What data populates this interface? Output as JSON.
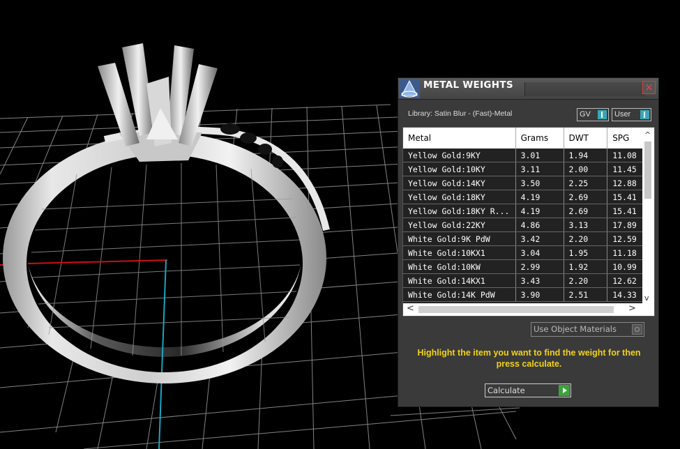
{
  "panel": {
    "title": "METAL WEIGHTS",
    "close_label": "×",
    "library": "Library: Satin Blur - (Fast)-Metal",
    "gv_label": "GV",
    "user_label": "User",
    "columns": [
      "Metal",
      "Grams",
      "DWT",
      "SPG"
    ],
    "rows": [
      [
        "Yellow Gold:9KY",
        "3.01",
        "1.94",
        "11.08"
      ],
      [
        "Yellow Gold:10KY",
        "3.11",
        "2.00",
        "11.45"
      ],
      [
        "Yellow Gold:14KY",
        "3.50",
        "2.25",
        "12.88"
      ],
      [
        "Yellow Gold:18KY",
        "4.19",
        "2.69",
        "15.41"
      ],
      [
        "Yellow Gold:18KY R...",
        "4.19",
        "2.69",
        "15.41"
      ],
      [
        "Yellow Gold:22KY",
        "4.86",
        "3.13",
        "17.89"
      ],
      [
        "White Gold:9K PdW",
        "3.42",
        "2.20",
        "12.59"
      ],
      [
        "White Gold:10KX1",
        "3.04",
        "1.95",
        "11.18"
      ],
      [
        "White Gold:10KW",
        "2.99",
        "1.92",
        "10.99"
      ],
      [
        "White Gold:14KX1",
        "3.43",
        "2.20",
        "12.62"
      ],
      [
        "White Gold:14K PdW",
        "3.90",
        "2.51",
        "14.33"
      ]
    ],
    "use_object_materials": "Use Object Materials",
    "hint": "Highlight the item you want to find the weight for then press calculate.",
    "calculate_label": "Calculate",
    "scroll_up": "^",
    "scroll_down": "v",
    "scroll_left": "<",
    "scroll_right": ">"
  },
  "colors": {
    "hint": "#f2d21a",
    "toggle_on": "#3aa6b8",
    "calculate_go": "#3ca33c",
    "axis_x": "#d01010",
    "axis_y": "#1aa6c0"
  }
}
